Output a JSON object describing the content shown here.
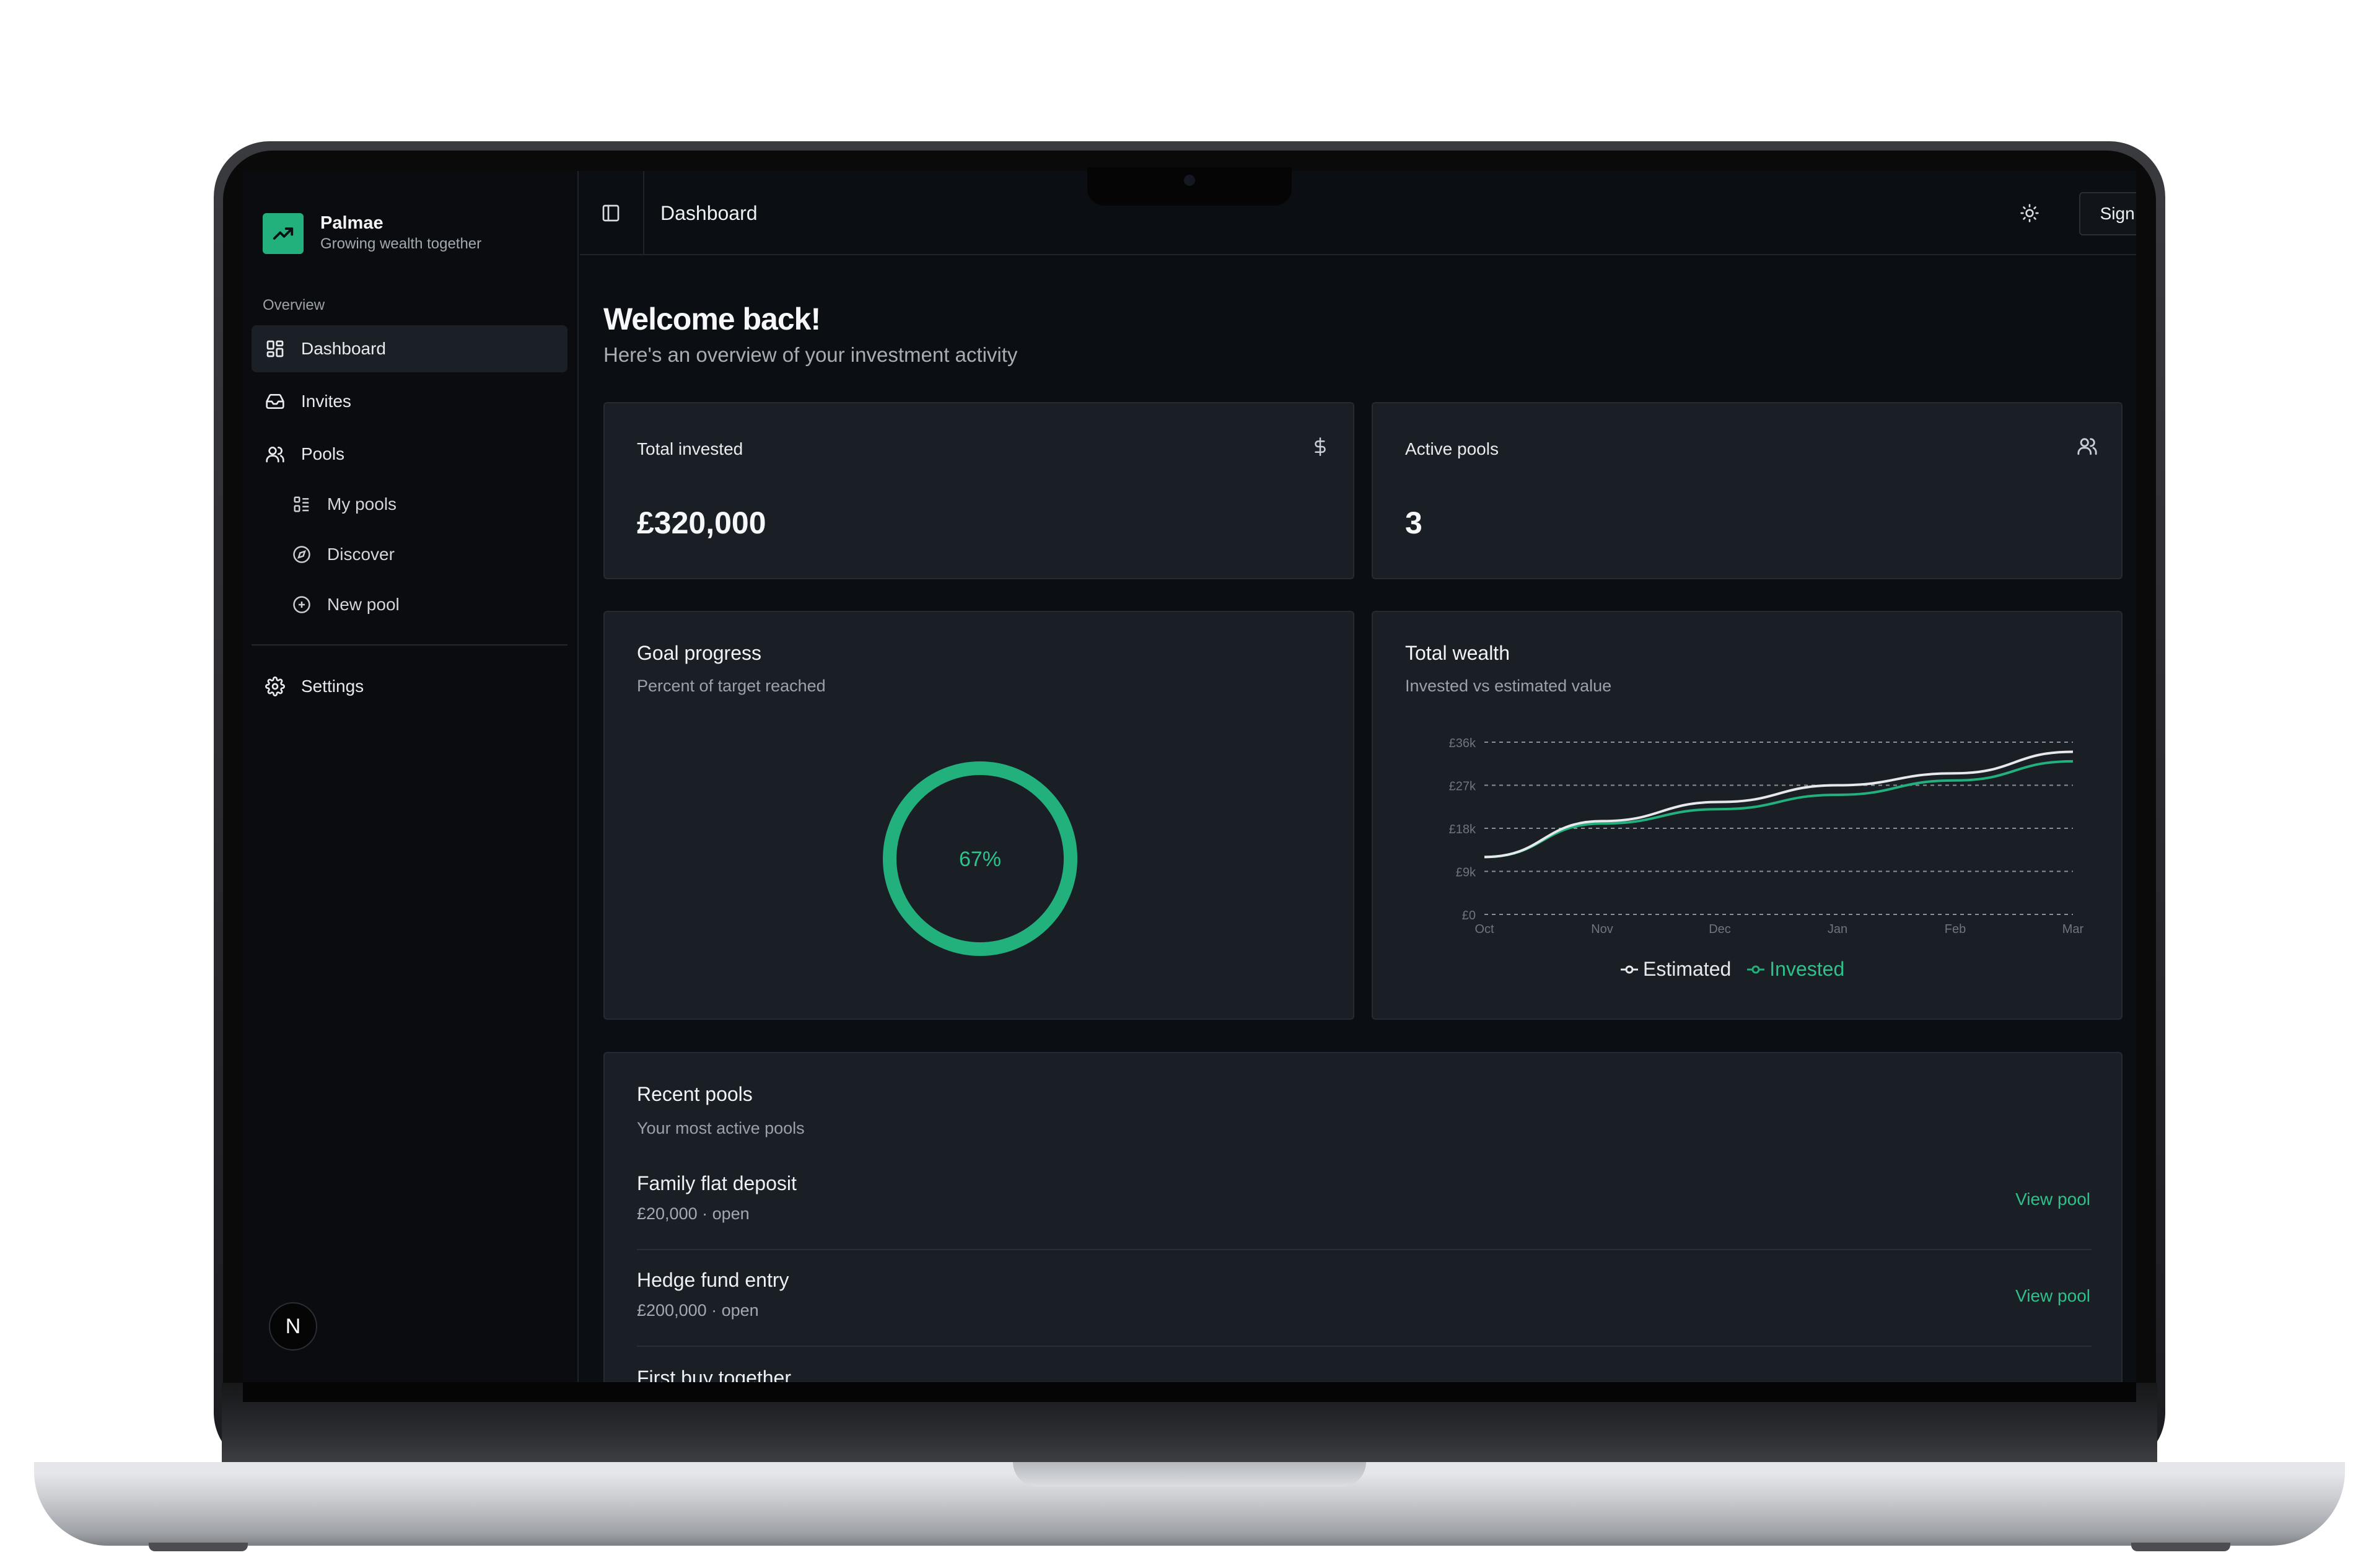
{
  "app": {
    "name": "Palmae",
    "tagline": "Growing wealth together",
    "accent": "#22b07d"
  },
  "sidebar": {
    "section_label": "Overview",
    "items": [
      {
        "label": "Dashboard",
        "icon": "layout-grid-icon",
        "active": true
      },
      {
        "label": "Invites",
        "icon": "inbox-icon"
      },
      {
        "label": "Pools",
        "icon": "users-icon"
      }
    ],
    "subitems": [
      {
        "label": "My pools",
        "icon": "list-icon"
      },
      {
        "label": "Discover",
        "icon": "compass-icon"
      },
      {
        "label": "New pool",
        "icon": "plus-circle-icon"
      }
    ],
    "settings": {
      "label": "Settings",
      "icon": "gear-icon"
    },
    "avatar_letter": "N"
  },
  "header": {
    "title": "Dashboard",
    "sign_out": "Sign out"
  },
  "main": {
    "welcome": "Welcome back!",
    "welcome_sub": "Here's an overview of your investment activity",
    "stats": [
      {
        "label": "Total invested",
        "value": "£320,000",
        "icon": "dollar-icon"
      },
      {
        "label": "Active pools",
        "value": "3",
        "icon": "users-icon"
      }
    ],
    "goal": {
      "title": "Goal progress",
      "subtitle": "Percent of target reached",
      "percent": 67,
      "label": "67%"
    },
    "wealth": {
      "title": "Total wealth",
      "subtitle": "Invested vs estimated value"
    },
    "recent": {
      "title": "Recent pools",
      "subtitle": "Your most active pools",
      "link_label": "View pool",
      "pools": [
        {
          "name": "Family flat deposit",
          "meta": "£20,000 · open"
        },
        {
          "name": "Hedge fund entry",
          "meta": "£200,000 · open"
        },
        {
          "name": "First buy together",
          "meta": ""
        }
      ]
    }
  },
  "chart_data": {
    "type": "line",
    "x": [
      "Oct",
      "Nov",
      "Dec",
      "Jan",
      "Feb",
      "Mar"
    ],
    "y_ticks": [
      "£0",
      "£9k",
      "£18k",
      "£27k",
      "£36k"
    ],
    "ylim": [
      0,
      36000
    ],
    "grid": true,
    "legend": "bottom",
    "series": [
      {
        "name": "Estimated",
        "color": "#e6e8eb",
        "values": [
          12000,
          19500,
          23500,
          27000,
          29500,
          34000
        ]
      },
      {
        "name": "Invested",
        "color": "#22b07d",
        "values": [
          12000,
          19000,
          22000,
          25000,
          28000,
          32000
        ]
      }
    ]
  }
}
